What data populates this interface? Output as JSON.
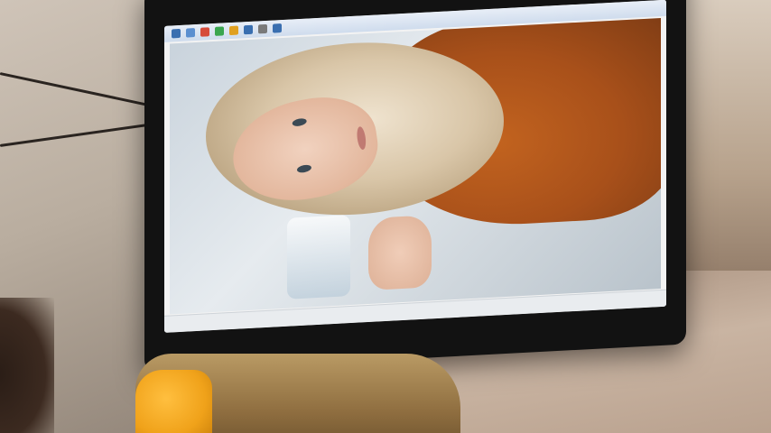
{
  "scene": {
    "description_visible_text": []
  },
  "colors": {
    "coat": "#b3581c",
    "hair": "#e3d2b6",
    "bottle_cap": "#f0a21a",
    "device_frame": "#121212"
  }
}
